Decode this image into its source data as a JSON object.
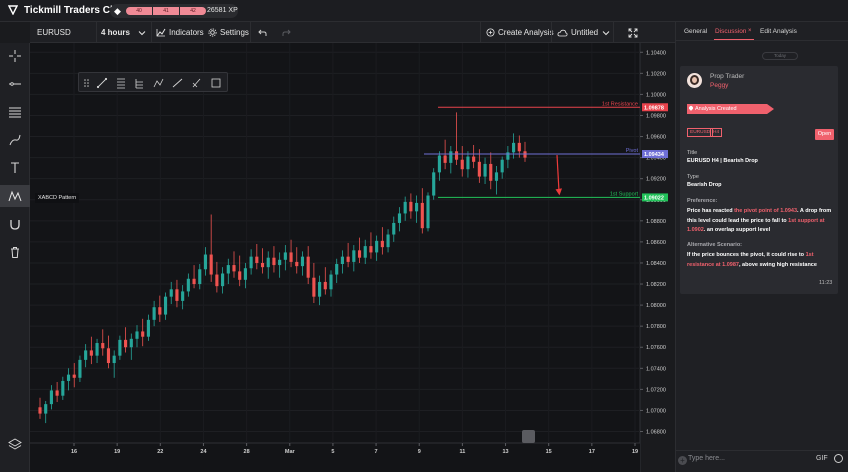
{
  "app": {
    "title": "Tickmill Traders Club",
    "xp_segments": [
      "40",
      "41",
      "42"
    ],
    "xp_value": "26581 XP"
  },
  "toolbar": {
    "symbol": "EURUSD",
    "interval": "4 hours",
    "indicators_label": "Indicators",
    "settings_label": "Settings",
    "create_analysis_label": "Create Analysis",
    "layout_label": "Untitled"
  },
  "left_toolbar": {
    "pattern_tooltip": "XABCD Pattern"
  },
  "chart_data": {
    "type": "candlestick",
    "symbol": "EURUSD",
    "interval": "4 hours",
    "price_axis": {
      "ticks": [
        "1.10400",
        "1.10200",
        "1.10000",
        "1.09800",
        "1.09600",
        "1.09400",
        "1.09200",
        "1.09000",
        "1.08800",
        "1.08600",
        "1.08400",
        "1.08200",
        "1.08000",
        "1.07800",
        "1.07600",
        "1.07400",
        "1.07200",
        "1.07000",
        "1.06800"
      ],
      "range": [
        1.0671,
        1.1045
      ]
    },
    "time_axis": {
      "ticks": [
        "16",
        "19",
        "22",
        "24",
        "28",
        "Mar",
        "5",
        "7",
        "9",
        "11",
        "13",
        "15",
        "17",
        "19"
      ]
    },
    "levels": [
      {
        "label": "1st Resistance",
        "price": 1.09878,
        "price_label": "1.09878",
        "color": "#e8434c"
      },
      {
        "label": "Pivot",
        "price": 1.09434,
        "price_label": "1.09434",
        "color": "#6f6fd6"
      },
      {
        "label": "1st Support",
        "price": 1.09022,
        "price_label": "1.09022",
        "color": "#22c25a"
      }
    ],
    "candles": [
      [
        1.0703,
        1.0712,
        1.0692,
        1.0697
      ],
      [
        1.0697,
        1.0709,
        1.0688,
        1.0706
      ],
      [
        1.0706,
        1.0724,
        1.0701,
        1.0719
      ],
      [
        1.0719,
        1.0727,
        1.0708,
        1.0714
      ],
      [
        1.0714,
        1.0732,
        1.071,
        1.0728
      ],
      [
        1.0728,
        1.074,
        1.0719,
        1.0734
      ],
      [
        1.0734,
        1.0745,
        1.0722,
        1.0731
      ],
      [
        1.0731,
        1.0752,
        1.0727,
        1.0748
      ],
      [
        1.0748,
        1.0763,
        1.0741,
        1.0757
      ],
      [
        1.0757,
        1.077,
        1.0744,
        1.0752
      ],
      [
        1.0752,
        1.0768,
        1.0745,
        1.0764
      ],
      [
        1.0764,
        1.0777,
        1.0752,
        1.0759
      ],
      [
        1.0759,
        1.0771,
        1.074,
        1.0745
      ],
      [
        1.0745,
        1.0757,
        1.0731,
        1.0752
      ],
      [
        1.0752,
        1.0771,
        1.0748,
        1.0767
      ],
      [
        1.0767,
        1.0779,
        1.0755,
        1.076
      ],
      [
        1.076,
        1.0773,
        1.0748,
        1.0768
      ],
      [
        1.0768,
        1.0781,
        1.076,
        1.0775
      ],
      [
        1.0775,
        1.0787,
        1.0761,
        1.077
      ],
      [
        1.077,
        1.0791,
        1.0766,
        1.0786
      ],
      [
        1.0786,
        1.0804,
        1.078,
        1.0798
      ],
      [
        1.0798,
        1.0809,
        1.0784,
        1.0791
      ],
      [
        1.0791,
        1.0812,
        1.0786,
        1.0808
      ],
      [
        1.0808,
        1.0822,
        1.0801,
        1.0815
      ],
      [
        1.0815,
        1.0824,
        1.0798,
        1.0804
      ],
      [
        1.0804,
        1.0819,
        1.0796,
        1.0813
      ],
      [
        1.0813,
        1.083,
        1.0808,
        1.0825
      ],
      [
        1.0825,
        1.0838,
        1.0816,
        1.082
      ],
      [
        1.082,
        1.0839,
        1.0815,
        1.0834
      ],
      [
        1.0834,
        1.0855,
        1.0828,
        1.0848
      ],
      [
        1.0848,
        1.0886,
        1.0822,
        1.0829
      ],
      [
        1.0829,
        1.0841,
        1.0812,
        1.0818
      ],
      [
        1.0818,
        1.0836,
        1.0811,
        1.083
      ],
      [
        1.083,
        1.0844,
        1.082,
        1.0838
      ],
      [
        1.0838,
        1.0851,
        1.0826,
        1.0832
      ],
      [
        1.0832,
        1.0847,
        1.0818,
        1.0824
      ],
      [
        1.0824,
        1.084,
        1.0816,
        1.0835
      ],
      [
        1.0835,
        1.0853,
        1.0829,
        1.0846
      ],
      [
        1.0846,
        1.0858,
        1.0834,
        1.084
      ],
      [
        1.084,
        1.0854,
        1.083,
        1.0836
      ],
      [
        1.0836,
        1.0851,
        1.0825,
        1.0845
      ],
      [
        1.0845,
        1.0856,
        1.0831,
        1.0838
      ],
      [
        1.0838,
        1.085,
        1.0826,
        1.0843
      ],
      [
        1.0843,
        1.0857,
        1.0833,
        1.085
      ],
      [
        1.085,
        1.0862,
        1.0836,
        1.0841
      ],
      [
        1.0841,
        1.0855,
        1.083,
        1.0837
      ],
      [
        1.0837,
        1.0851,
        1.0828,
        1.0846
      ],
      [
        1.0846,
        1.0856,
        1.082,
        1.0826
      ],
      [
        1.0826,
        1.084,
        1.0802,
        1.0808
      ],
      [
        1.0808,
        1.0828,
        1.08,
        1.0822
      ],
      [
        1.0822,
        1.0836,
        1.081,
        1.0815
      ],
      [
        1.0815,
        1.0833,
        1.0808,
        1.0829
      ],
      [
        1.0829,
        1.0844,
        1.0821,
        1.0839
      ],
      [
        1.0839,
        1.0852,
        1.083,
        1.0846
      ],
      [
        1.0846,
        1.0859,
        1.0836,
        1.0841
      ],
      [
        1.0841,
        1.0857,
        1.0832,
        1.0852
      ],
      [
        1.0852,
        1.0864,
        1.084,
        1.0845
      ],
      [
        1.0845,
        1.0862,
        1.0839,
        1.0856
      ],
      [
        1.0856,
        1.0869,
        1.0844,
        1.085
      ],
      [
        1.085,
        1.0866,
        1.0842,
        1.0861
      ],
      [
        1.0861,
        1.0874,
        1.0848,
        1.0855
      ],
      [
        1.0855,
        1.0872,
        1.085,
        1.0867
      ],
      [
        1.0867,
        1.0884,
        1.086,
        1.0878
      ],
      [
        1.0878,
        1.0893,
        1.087,
        1.0887
      ],
      [
        1.0887,
        1.0903,
        1.088,
        1.0898
      ],
      [
        1.0898,
        1.0906,
        1.0882,
        1.0889
      ],
      [
        1.0889,
        1.0904,
        1.0878,
        1.0897
      ],
      [
        1.0897,
        1.0911,
        1.0868,
        1.0873
      ],
      [
        1.0873,
        1.0907,
        1.087,
        1.0904
      ],
      [
        1.0904,
        1.093,
        1.09,
        1.0926
      ],
      [
        1.0926,
        1.0946,
        1.0918,
        1.0942
      ],
      [
        1.0942,
        1.0957,
        1.0929,
        1.0935
      ],
      [
        1.0935,
        1.0951,
        1.0925,
        1.0946
      ],
      [
        1.0946,
        1.0983,
        1.0933,
        1.0938
      ],
      [
        1.0938,
        1.0951,
        1.0922,
        1.0929
      ],
      [
        1.0929,
        1.0946,
        1.0921,
        1.0941
      ],
      [
        1.0941,
        1.0952,
        1.093,
        1.0936
      ],
      [
        1.0936,
        1.0948,
        1.0916,
        1.0922
      ],
      [
        1.0922,
        1.094,
        1.0915,
        1.0934
      ],
      [
        1.0934,
        1.0945,
        1.091,
        1.0918
      ],
      [
        1.0918,
        1.0932,
        1.0905,
        1.0926
      ],
      [
        1.0926,
        1.0941,
        1.092,
        1.0938
      ],
      [
        1.0938,
        1.0951,
        1.093,
        1.0945
      ],
      [
        1.0945,
        1.0963,
        1.0939,
        1.0954
      ],
      [
        1.0954,
        1.0961,
        1.094,
        1.0946
      ],
      [
        1.0946,
        1.0955,
        1.0936,
        1.094
      ]
    ]
  },
  "right_panel": {
    "tabs": [
      "General",
      "Discussion",
      "Edit Analysis"
    ],
    "date_divider": "Today",
    "author_role": "Prop Trader",
    "author_name": "Peggy",
    "event_label": "Analysis Created",
    "tags": [
      "EURUSD",
      "H4"
    ],
    "status_button": "Open",
    "title_heading": "Title",
    "title_value": "EURUSD H4 | Bearish Drop",
    "type_heading": "Type",
    "type_value": "Bearish Drop",
    "preference_heading": "Preference:",
    "preference_parts": [
      "Price has reacted ",
      "the pivot point of 1.0943",
      ". A drop from this level could lead the price to fall to ",
      "1st support at 1.0902",
      ". an overlap support level"
    ],
    "alternative_heading": "Alternative Scenario:",
    "alternative_parts": [
      "If the price bounces the pivot, it could rise to ",
      "1st resistance at 1.0987",
      ", above swing high resistance"
    ],
    "timestamp": "11:23",
    "input_placeholder": "Type here...",
    "gif_label": "GIF"
  }
}
